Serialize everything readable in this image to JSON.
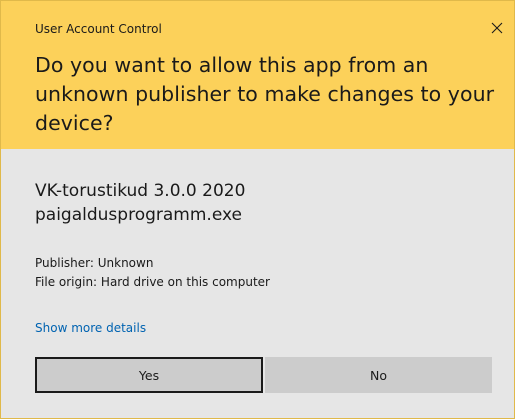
{
  "window": {
    "title": "User Account Control"
  },
  "header": {
    "question": "Do you want to allow this app from an unknown publisher to make changes to your device?",
    "background_color": "#fcd15a",
    "close_icon": "close-icon"
  },
  "app": {
    "name": "VK-torustikud 3.0.0 2020",
    "file": "paigaldusprogramm.exe",
    "publisher": "Publisher: Unknown",
    "origin": "File origin: Hard drive on this computer"
  },
  "links": {
    "details": "Show more details",
    "link_color": "#0063b1"
  },
  "buttons": {
    "yes_label": "Yes",
    "no_label": "No",
    "button_color": "#cccccc"
  }
}
